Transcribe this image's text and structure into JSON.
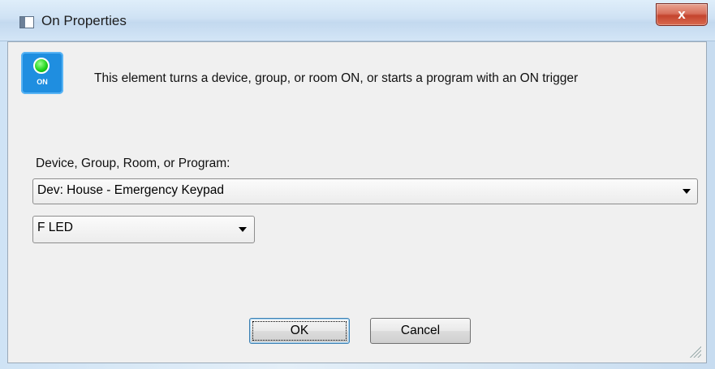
{
  "window": {
    "title": "On Properties",
    "close_label": "x"
  },
  "icon": {
    "label": "ON"
  },
  "description": "This element turns a device, group, or room ON, or starts a program with an ON trigger",
  "target": {
    "label": "Device, Group, Room, or Program:",
    "selected": "Dev: House - Emergency Keypad"
  },
  "subitem": {
    "selected": "F LED"
  },
  "buttons": {
    "ok": "OK",
    "cancel": "Cancel"
  }
}
